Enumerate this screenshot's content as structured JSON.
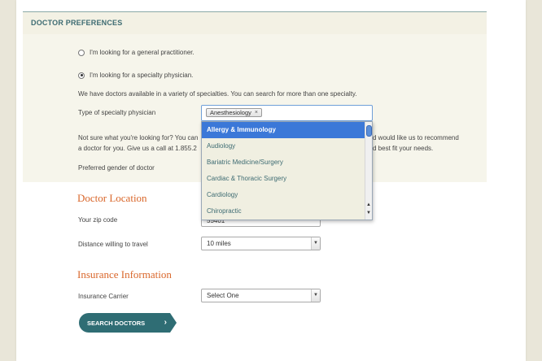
{
  "doctor_prefs": {
    "title": "DOCTOR PREFERENCES",
    "radio_general": "I'm looking for a general practitioner.",
    "radio_specialty": "I'm looking for a specialty physician.",
    "specialty_info": "We have doctors available in a variety of specialties. You can search for more than one specialty.",
    "specialty_label": "Type of specialty physician",
    "selected_tag": "Anesthesiology",
    "tag_remove": "×",
    "not_sure_line1_left": "Not sure what you're looking for? You can",
    "not_sure_line1_right": "d would like us to recommend",
    "not_sure_line2_left": "a doctor for you. Give us a call at 1.855.2",
    "not_sure_line2_right": "d best fit your needs.",
    "gender_label": "Preferred gender of doctor"
  },
  "specialty_dropdown": {
    "options": [
      "Allergy & Immunology",
      "Audiology",
      "Bariatric Medicine/Surgery",
      "Cardiac & Thoracic Surgery",
      "Cardiology",
      "Chiropractic"
    ],
    "highlighted": "Allergy & Immunology"
  },
  "location": {
    "heading": "Doctor Location",
    "zip_label": "Your zip code",
    "zip_value": "55401",
    "distance_label": "Distance willing to travel",
    "distance_value": "10 miles"
  },
  "insurance": {
    "heading": "Insurance Information",
    "carrier_label": "Insurance Carrier",
    "carrier_value": "Select One"
  },
  "actions": {
    "search_label": "SEARCH DOCTORS",
    "chevron": "›"
  },
  "icons": {
    "select_arrow": "chevron-down-icon",
    "scroll_up": "arrow-up-icon",
    "scroll_down": "arrow-down-icon"
  },
  "colors": {
    "accent_teal": "#2f6d74",
    "heading_orange": "#d9662a",
    "highlight_blue": "#3b78d8",
    "panel_bg": "#f6f5eb"
  }
}
